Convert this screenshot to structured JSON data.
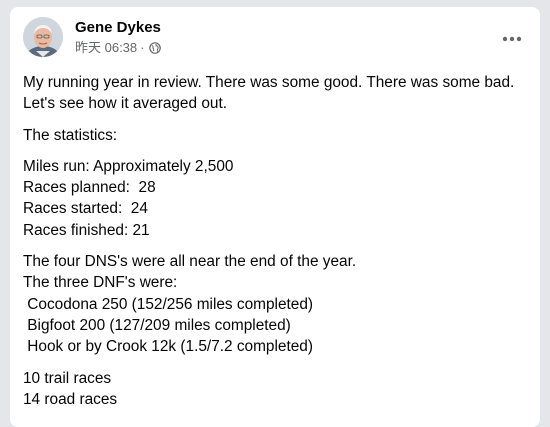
{
  "post": {
    "author": "Gene Dykes",
    "timestamp": "昨天 06:38",
    "audience_icon": "globe-icon",
    "more_icon": "more-options-icon",
    "paragraphs": [
      "My running year in review.  There was some good.  There was some bad.  Let's see how it averaged out.",
      "The statistics:",
      "Miles run: Approximately 2,500\nRaces planned:  28\nRaces started:  24\nRaces finished: 21",
      "The four DNS's were all near the end of the year.\nThe three DNF's were:\n Cocodona 250 (152/256 miles completed)\n Bigfoot 200 (127/209 miles completed)\n Hook or by Crook 12k (1.5/7.2 completed)",
      "10 trail races\n14 road races"
    ]
  },
  "colors": {
    "background": "#e4e6ea",
    "card": "#ffffff",
    "text_primary": "#050505",
    "text_secondary": "#65676b"
  }
}
